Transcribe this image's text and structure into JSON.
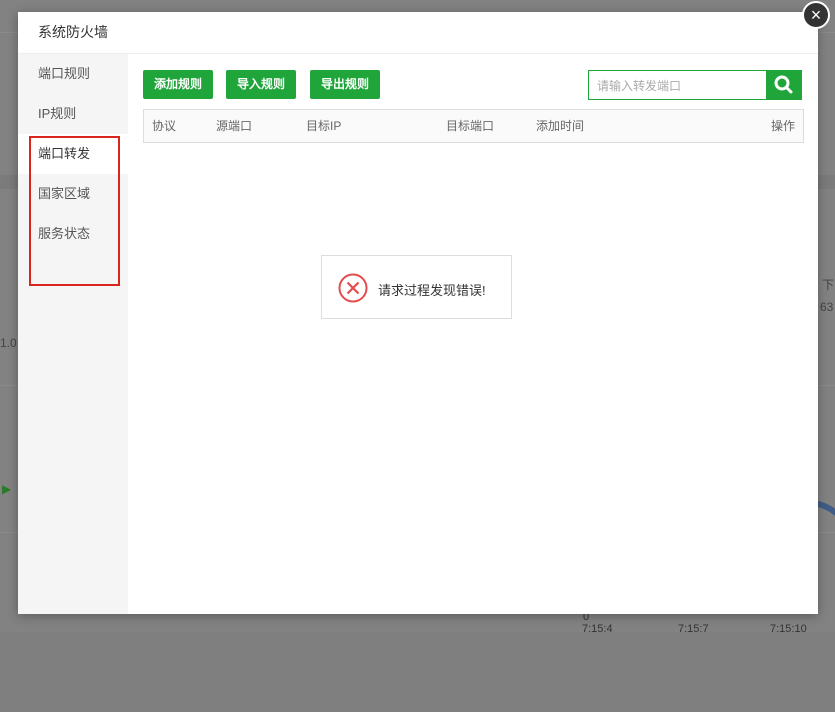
{
  "dialog": {
    "title": "系统防火墙",
    "close_symbol": "×"
  },
  "sidebar": {
    "items": [
      {
        "label": "端口规则"
      },
      {
        "label": "IP规则"
      },
      {
        "label": "端口转发"
      },
      {
        "label": "国家区域"
      },
      {
        "label": "服务状态"
      }
    ],
    "active_index": 2
  },
  "toolbar": {
    "add_label": "添加规则",
    "import_label": "导入规则",
    "export_label": "导出规则"
  },
  "search": {
    "placeholder": "请输入转发端口",
    "value": ""
  },
  "table": {
    "columns": [
      "协议",
      "源端口",
      "目标IP",
      "目标端口",
      "添加时间",
      "操作"
    ],
    "rows": []
  },
  "toast": {
    "message": "请求过程发现错误!"
  },
  "background": {
    "right_label_1": "下",
    "right_label_2": "63",
    "left_value": "1.0",
    "axis_zero": "0",
    "axis_ticks": [
      "7:15:4",
      "7:15:7",
      "7:15:10"
    ]
  },
  "colors": {
    "primary": "#20a53a",
    "highlight_border": "#d9261c",
    "error": "#e44d4d"
  }
}
